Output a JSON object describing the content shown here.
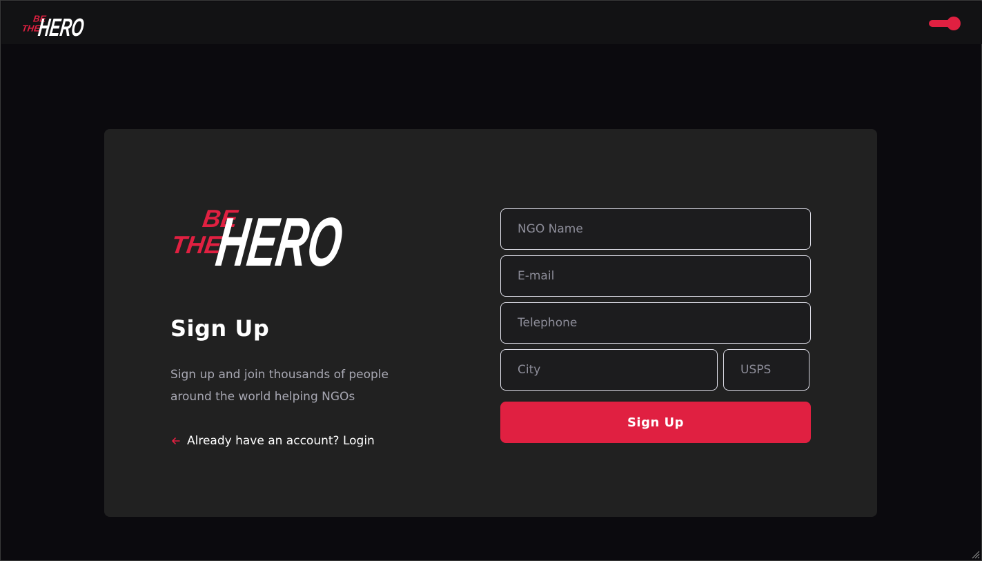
{
  "header": {
    "logo": {
      "be": "BE",
      "the": "THE",
      "hero": "HERO"
    },
    "theme_toggle": {
      "state": "on",
      "color": "#e02041"
    }
  },
  "card": {
    "logo": {
      "be": "BE",
      "the": "THE",
      "hero": "HERO"
    },
    "title": "Sign Up",
    "description": "Sign up and join thousands of people around the world helping NGOs",
    "login_link": "Already have an account? Login",
    "login_icon": "arrow-left-icon"
  },
  "form": {
    "ngo_name": {
      "placeholder": "NGO Name",
      "value": ""
    },
    "email": {
      "placeholder": "E-mail",
      "value": ""
    },
    "telephone": {
      "placeholder": "Telephone",
      "value": ""
    },
    "city": {
      "placeholder": "City",
      "value": ""
    },
    "usps": {
      "placeholder": "USPS",
      "value": ""
    },
    "submit_label": "Sign Up"
  },
  "colors": {
    "accent": "#e02041",
    "background": "#0c0b0f",
    "card": "#212121",
    "text": "#ffffff",
    "muted": "#a8a8b3"
  }
}
